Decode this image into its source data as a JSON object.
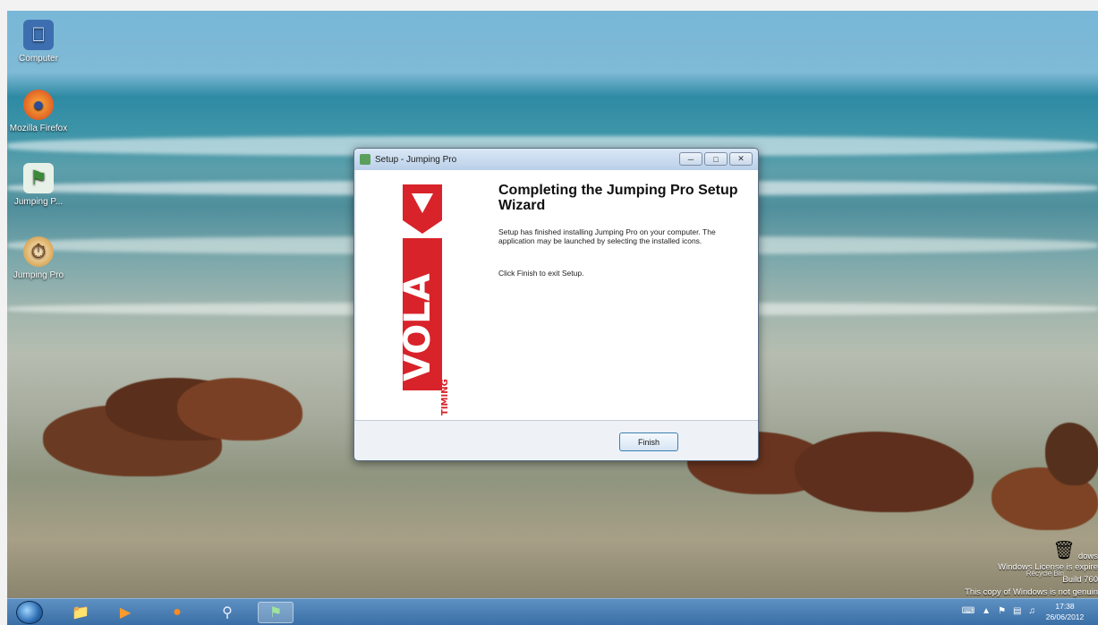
{
  "desktop": {
    "icons": [
      {
        "label": "Computer",
        "icon": "computer-icon"
      },
      {
        "label": "Mozilla Firefox",
        "icon": "firefox-icon"
      },
      {
        "label": "Jumping P...",
        "icon": "jumping-pro-shortcut-icon"
      },
      {
        "label": "Jumping Pro",
        "icon": "jumping-pro-icon"
      }
    ],
    "recycle_label": "Recycle Bin",
    "watermark": {
      "line1": "Windows License is expire",
      "line2": "Build 760",
      "line3": "This copy of Windows is not genuin",
      "fragment": "dows"
    }
  },
  "dialog": {
    "title": "Setup - Jumping Pro",
    "heading": "Completing the Jumping Pro Setup Wizard",
    "message1": "Setup has finished installing Jumping Pro on your computer. The application may be launched by selecting the installed icons.",
    "message2": "Click Finish to exit Setup.",
    "finish_label": "Finish",
    "logo_text": "VOLA",
    "logo_subtext": "TIMING"
  },
  "taskbar": {
    "items": [
      {
        "icon": "windows-explorer-icon"
      },
      {
        "icon": "media-player-icon"
      },
      {
        "icon": "firefox-icon"
      },
      {
        "icon": "search-icon"
      },
      {
        "icon": "jumping-pro-icon"
      }
    ],
    "clock_time": "17:38",
    "clock_date": "26/06/2012"
  },
  "colors": {
    "accent": "#3a6fa6",
    "logo_red": "#d8232a"
  }
}
